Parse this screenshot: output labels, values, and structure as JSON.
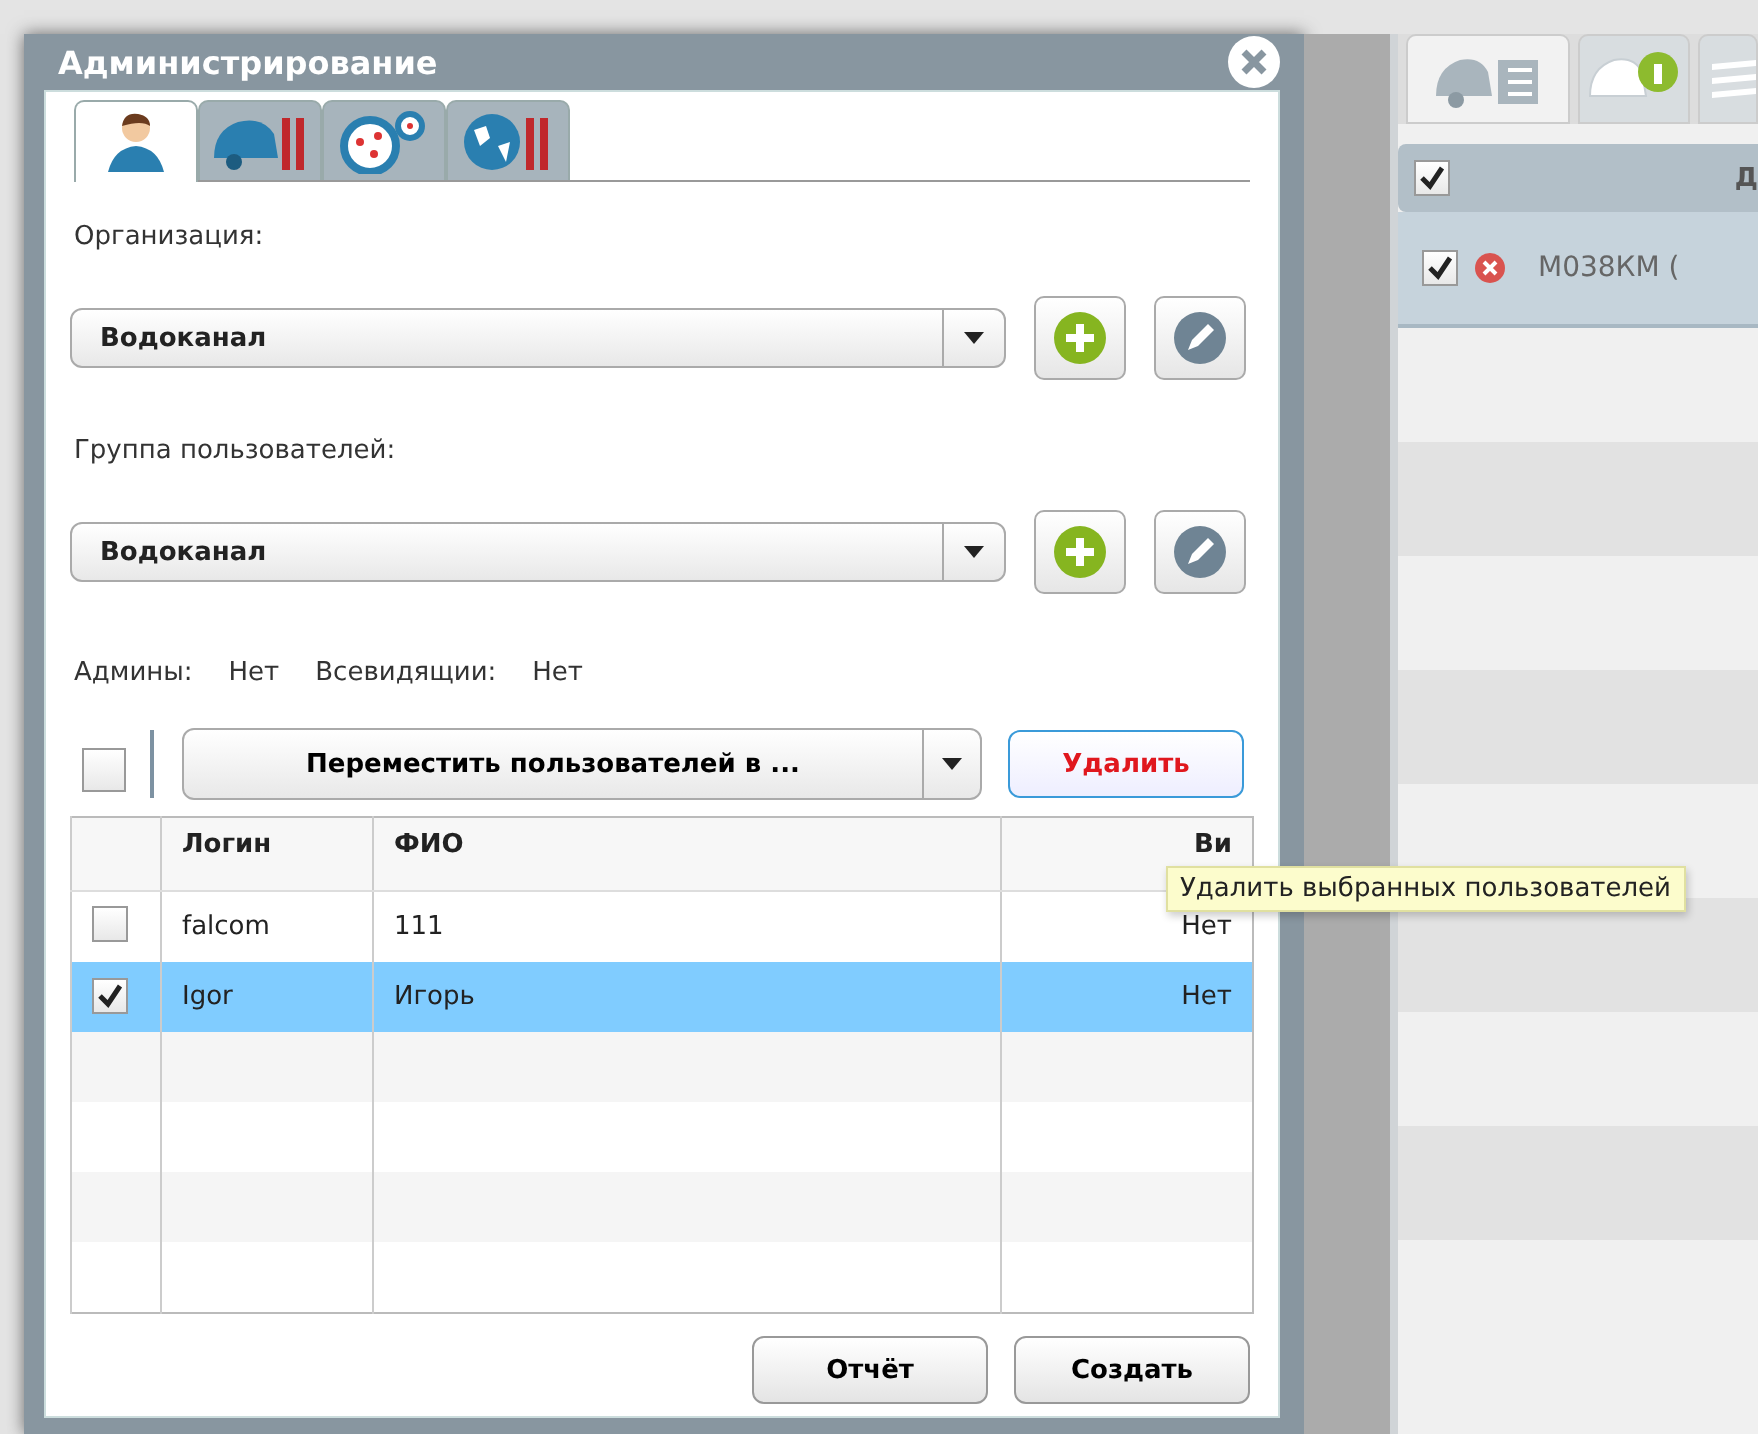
{
  "window": {
    "title": "Администрирование"
  },
  "tabs": [
    {
      "kind": "user",
      "selected": true
    },
    {
      "kind": "car-tools",
      "selected": false
    },
    {
      "kind": "gauge",
      "selected": false
    },
    {
      "kind": "globe-tools",
      "selected": false
    }
  ],
  "organization": {
    "label": "Организация:",
    "value": "Водоканал"
  },
  "group": {
    "label": "Группа пользователей:",
    "value": "Водоканал"
  },
  "flags": [
    {
      "label": "Админы:",
      "value": "Нет"
    },
    {
      "label": "Всевидящии:",
      "value": "Нет"
    }
  ],
  "toolbar": {
    "select_all": false,
    "move_button": "Переместить пользователей в ...",
    "delete_button": "Удалить"
  },
  "table": {
    "columns": [
      "Логин",
      "ФИО",
      "Ви"
    ],
    "rows": [
      {
        "checked": false,
        "selected": false,
        "login": "falcom",
        "name": "111",
        "visible": "Нет"
      },
      {
        "checked": true,
        "selected": true,
        "login": "Igor",
        "name": "Игорь",
        "visible": "Нет"
      }
    ]
  },
  "tooltip": "Удалить выбранных пользователей",
  "buttons": [
    "Отчёт",
    "Создать"
  ],
  "right_panel": {
    "tabs": [
      {
        "kind": "car-list",
        "selected": true
      },
      {
        "kind": "car-bulb",
        "selected": false
      },
      {
        "kind": "layers",
        "selected": false
      }
    ],
    "header": {
      "checked": true,
      "column_1": "Д"
    },
    "rows": [
      {
        "checked": true,
        "text": "М038КМ ("
      }
    ]
  }
}
